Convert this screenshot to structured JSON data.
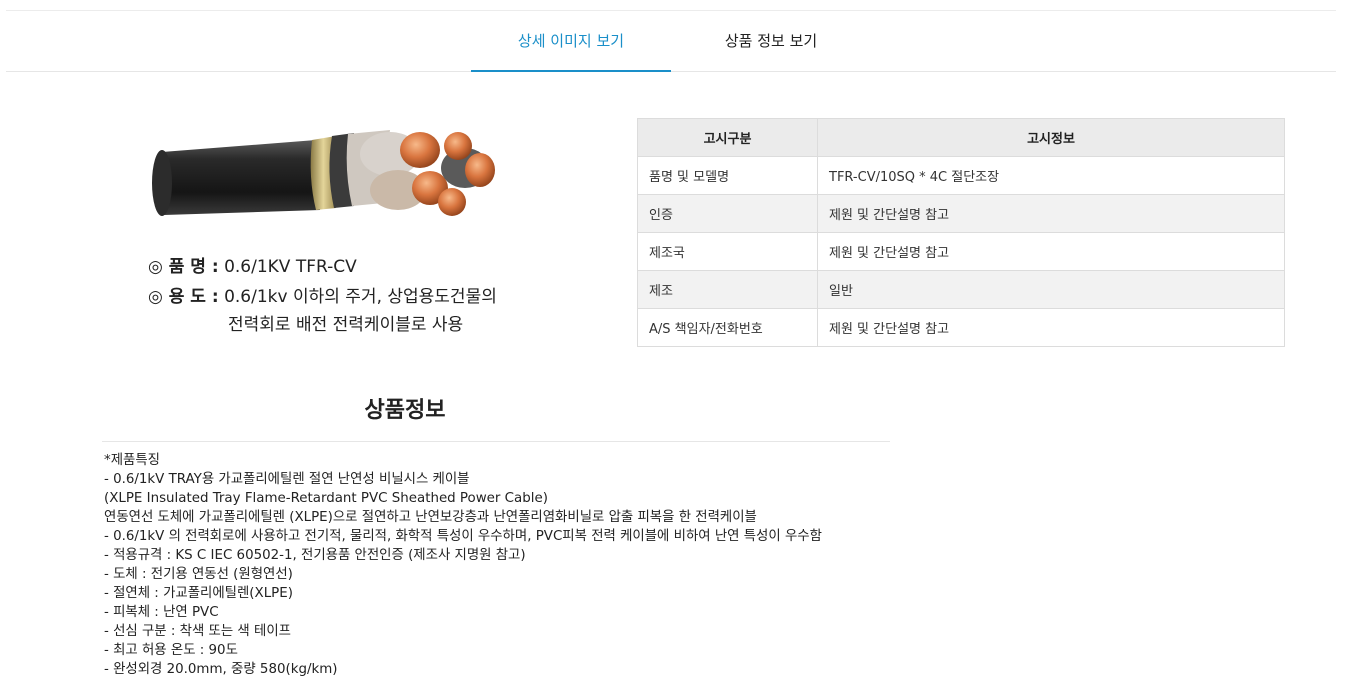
{
  "tabs": [
    {
      "label": "상세 이미지 보기",
      "active": true
    },
    {
      "label": "상품 정보 보기",
      "active": false
    }
  ],
  "product_image": {
    "name_key": "◎ 품  명 :",
    "name_value": "0.6/1KV TFR-CV",
    "use_key": "◎ 용  도 :",
    "use_value": "0.6/1kv 이하의 주거, 상업용도건물의",
    "use_value_2": "전력회로 배전 전력케이블로 사용"
  },
  "notice_table": {
    "headers": [
      "고시구분",
      "고시정보"
    ],
    "rows": [
      [
        "품명 및 모델명",
        "TFR-CV/10SQ * 4C 절단조장"
      ],
      [
        "인증",
        "제원 및 간단설명 참고"
      ],
      [
        "제조국",
        "제원 및 간단설명 참고"
      ],
      [
        "제조",
        "일반"
      ],
      [
        "A/S 책임자/전화번호",
        "제원 및 간단설명 참고"
      ]
    ]
  },
  "section": {
    "title": "상품정보",
    "lines": [
      "*제품특징",
      "- 0.6/1kV TRAY용 가교폴리에틸렌 절연 난연성 비닐시스 케이블",
      "(XLPE Insulated Tray Flame-Retardant PVC Sheathed Power Cable)",
      "연동연선 도체에 가교폴리에틸렌 (XLPE)으로 절연하고 난연보강층과 난연폴리염화비닐로 압출 피복을 한 전력케이블",
      "- 0.6/1kV 의 전력회로에 사용하고 전기적, 물리적, 화학적 특성이 우수하며, PVC피복 전력 케이블에 비하여 난연 특성이 우수함",
      "- 적용규격 : KS C IEC 60502-1, 전기용품 안전인증 (제조사 지명원 참고)",
      "- 도체 : 전기용 연동선 (원형연선)",
      "- 절연체 : 가교폴리에틸렌(XLPE)",
      "- 피복체 : 난연 PVC",
      "- 선심 구분 : 착색 또는 색 테이프",
      "- 최고 허용 온도 : 90도",
      "- 완성외경 20.0mm, 중량 580(kg/km)"
    ]
  },
  "colors": {
    "accent": "#1a8fc9",
    "table_header_bg": "#ebebeb",
    "table_alt_bg": "#f2f2f2"
  }
}
